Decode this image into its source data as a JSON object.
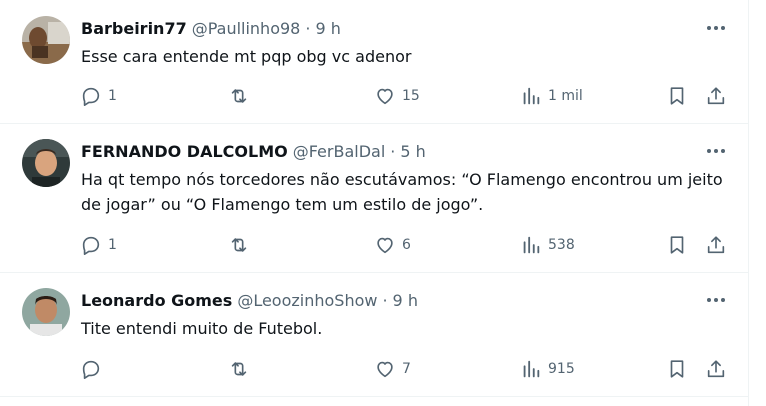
{
  "tweets": [
    {
      "name": "Barbeirin77",
      "handle": "@Paullinho98",
      "dot": "·",
      "time": "9 h",
      "text": "Esse cara entende mt pqp obg vc adenor",
      "replies": "1",
      "retweets": "",
      "likes": "15",
      "views": "1 mil",
      "more_icon": "more-horizontal-icon"
    },
    {
      "name": "FERNANDO DALCOLMO",
      "handle": "@FerBalDal",
      "dot": "·",
      "time": "5 h",
      "text": "Ha qt tempo nós torcedores não escutávamos: “O Flamengo encontrou um jeito de jogar” ou “O Flamengo tem um estilo de jogo”.",
      "replies": "1",
      "retweets": "",
      "likes": "6",
      "views": "538",
      "more_icon": "more-horizontal-icon"
    },
    {
      "name": "Leonardo Gomes",
      "handle": "@LeoozinhoShow",
      "dot": "·",
      "time": "9 h",
      "text": "Tite entendi muito de Futebol.",
      "replies": "",
      "retweets": "",
      "likes": "7",
      "views": "915",
      "more_icon": "more-horizontal-icon"
    }
  ],
  "colors": {
    "text_primary": "#0f1419",
    "text_secondary": "#536471",
    "divider": "#eff3f4",
    "background": "#ffffff"
  },
  "icons": [
    "reply-icon",
    "retweet-icon",
    "like-icon",
    "views-icon",
    "bookmark-icon",
    "share-icon",
    "more-horizontal-icon"
  ]
}
